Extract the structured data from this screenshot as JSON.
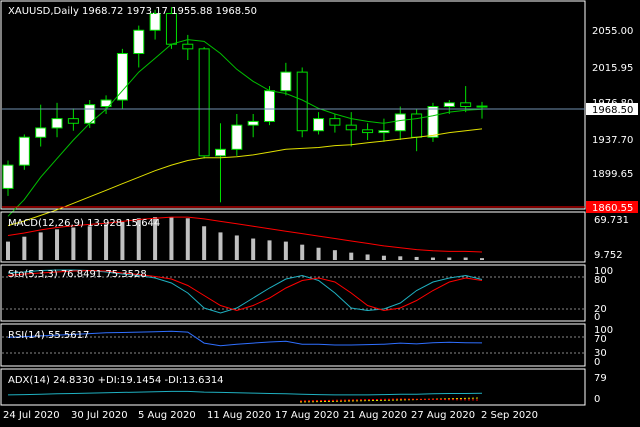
{
  "main": {
    "header": "XAUUSD,Daily  1968.72 1973.17 1955.88 1968.50",
    "price_axis": [
      "2055.00",
      "2015.95",
      "1976.80",
      "1937.70",
      "1899.65",
      "1860.55"
    ],
    "current_price": "1968.50",
    "low_label": "1860.55"
  },
  "macd": {
    "header": "MACD(12,26,9) 13.928 15.644",
    "axis": [
      "69.731",
      "9.752"
    ]
  },
  "sto": {
    "header": "Sto(5,3,3) 76.8491 75.3528",
    "axis": [
      "100",
      "80",
      "20",
      "0"
    ]
  },
  "rsi": {
    "header": "RSI(14) 55.5617",
    "axis": [
      "100",
      "70",
      "30",
      "0"
    ]
  },
  "adx": {
    "header": "ADX(14) 24.8330 +DI:19.1454 -DI:13.6314",
    "axis": [
      "79",
      "0"
    ]
  },
  "time_axis": [
    "24 Jul 2020",
    "30 Jul 2020",
    "5 Aug 2020",
    "11 Aug 2020",
    "17 Aug 2020",
    "21 Aug 2020",
    "27 Aug 2020",
    "2 Sep 2020"
  ],
  "colors": {
    "bg": "#000000",
    "grid": "#ffffff",
    "bull": "#ffffff",
    "bear": "#000000",
    "ma_fast": "#00c000",
    "ma_slow": "#e0e000",
    "macd_signal": "#ff0000",
    "sto_main": "#1fb0c0",
    "sto_signal": "#ff0000",
    "rsi": "#2f6fff"
  },
  "chart_data": {
    "type": "candlestick",
    "ylim": [
      1860,
      2075
    ],
    "candles": [
      {
        "o": 1880,
        "h": 1910,
        "l": 1872,
        "c": 1905
      },
      {
        "o": 1905,
        "h": 1938,
        "l": 1900,
        "c": 1935
      },
      {
        "o": 1935,
        "h": 1970,
        "l": 1925,
        "c": 1945
      },
      {
        "o": 1945,
        "h": 1972,
        "l": 1935,
        "c": 1955
      },
      {
        "o": 1955,
        "h": 1966,
        "l": 1942,
        "c": 1950
      },
      {
        "o": 1950,
        "h": 1975,
        "l": 1945,
        "c": 1970
      },
      {
        "o": 1968,
        "h": 1980,
        "l": 1960,
        "c": 1975
      },
      {
        "o": 1975,
        "h": 2030,
        "l": 1965,
        "c": 2025
      },
      {
        "o": 2025,
        "h": 2055,
        "l": 2010,
        "c": 2050
      },
      {
        "o": 2050,
        "h": 2072,
        "l": 2040,
        "c": 2068
      },
      {
        "o": 2068,
        "h": 2075,
        "l": 2030,
        "c": 2035
      },
      {
        "o": 2035,
        "h": 2045,
        "l": 2018,
        "c": 2030
      },
      {
        "o": 2030,
        "h": 2032,
        "l": 1912,
        "c": 1915
      },
      {
        "o": 1915,
        "h": 1950,
        "l": 1865,
        "c": 1922
      },
      {
        "o": 1922,
        "h": 1960,
        "l": 1915,
        "c": 1948
      },
      {
        "o": 1948,
        "h": 1960,
        "l": 1935,
        "c": 1952
      },
      {
        "o": 1952,
        "h": 1990,
        "l": 1948,
        "c": 1985
      },
      {
        "o": 1985,
        "h": 2015,
        "l": 1980,
        "c": 2005
      },
      {
        "o": 2005,
        "h": 2010,
        "l": 1935,
        "c": 1942
      },
      {
        "o": 1942,
        "h": 1962,
        "l": 1938,
        "c": 1955
      },
      {
        "o": 1955,
        "h": 1960,
        "l": 1940,
        "c": 1948
      },
      {
        "o": 1948,
        "h": 1962,
        "l": 1925,
        "c": 1943
      },
      {
        "o": 1943,
        "h": 1950,
        "l": 1932,
        "c": 1940
      },
      {
        "o": 1940,
        "h": 1955,
        "l": 1930,
        "c": 1942
      },
      {
        "o": 1942,
        "h": 1968,
        "l": 1932,
        "c": 1960
      },
      {
        "o": 1960,
        "h": 1965,
        "l": 1920,
        "c": 1935
      },
      {
        "o": 1935,
        "h": 1972,
        "l": 1930,
        "c": 1968
      },
      {
        "o": 1968,
        "h": 1975,
        "l": 1960,
        "c": 1972
      },
      {
        "o": 1972,
        "h": 1990,
        "l": 1962,
        "c": 1968
      },
      {
        "o": 1968,
        "h": 1973,
        "l": 1955,
        "c": 1968.5
      }
    ],
    "ma_fast": [
      1850,
      1868,
      1892,
      1912,
      1932,
      1950,
      1965,
      1985,
      2005,
      2020,
      2035,
      2040,
      2038,
      2025,
      2008,
      1995,
      1985,
      1982,
      1975,
      1966,
      1960,
      1955,
      1952,
      1950,
      1953,
      1955,
      1958,
      1962,
      1964,
      1965
    ],
    "ma_slow": [
      1840,
      1845,
      1851,
      1857,
      1864,
      1871,
      1878,
      1885,
      1892,
      1899,
      1905,
      1910,
      1913,
      1913,
      1914,
      1916,
      1919,
      1922,
      1923,
      1924,
      1926,
      1927,
      1929,
      1931,
      1933,
      1935,
      1937,
      1940,
      1942,
      1944
    ],
    "macd_hist": [
      30,
      38,
      45,
      50,
      53,
      55,
      58,
      62,
      68,
      70,
      70,
      68,
      55,
      45,
      40,
      35,
      32,
      30,
      25,
      20,
      16,
      12,
      9,
      7,
      6,
      5,
      4,
      4,
      4,
      3
    ],
    "macd_signal": [
      40,
      44,
      49,
      53,
      56,
      58,
      60,
      63,
      66,
      68,
      70,
      70,
      67,
      63,
      59,
      55,
      51,
      47,
      43,
      39,
      35,
      31,
      27,
      23,
      20,
      17,
      15,
      14,
      14,
      13
    ],
    "sto_k": [
      90,
      92,
      95,
      96,
      96,
      95,
      92,
      88,
      85,
      80,
      70,
      50,
      20,
      10,
      20,
      40,
      60,
      78,
      85,
      75,
      50,
      20,
      15,
      18,
      30,
      55,
      72,
      80,
      85,
      77
    ],
    "sto_d": [
      85,
      88,
      90,
      92,
      94,
      95,
      94,
      90,
      87,
      83,
      78,
      65,
      45,
      25,
      15,
      25,
      40,
      60,
      75,
      80,
      72,
      50,
      25,
      15,
      20,
      35,
      55,
      72,
      80,
      75
    ],
    "rsi": [
      70,
      72,
      74,
      76,
      78,
      80,
      82,
      83,
      84,
      85,
      86,
      84,
      55,
      48,
      52,
      55,
      58,
      60,
      52,
      52,
      50,
      50,
      51,
      52,
      55,
      53,
      56,
      57,
      56,
      55.5
    ],
    "adx": [
      20,
      21,
      22,
      23,
      24,
      25,
      26,
      27,
      28,
      29,
      30,
      30,
      28,
      27,
      26,
      25,
      24,
      23,
      22,
      21,
      20,
      20,
      20,
      21,
      22,
      22,
      23,
      24,
      24,
      24.8
    ]
  }
}
